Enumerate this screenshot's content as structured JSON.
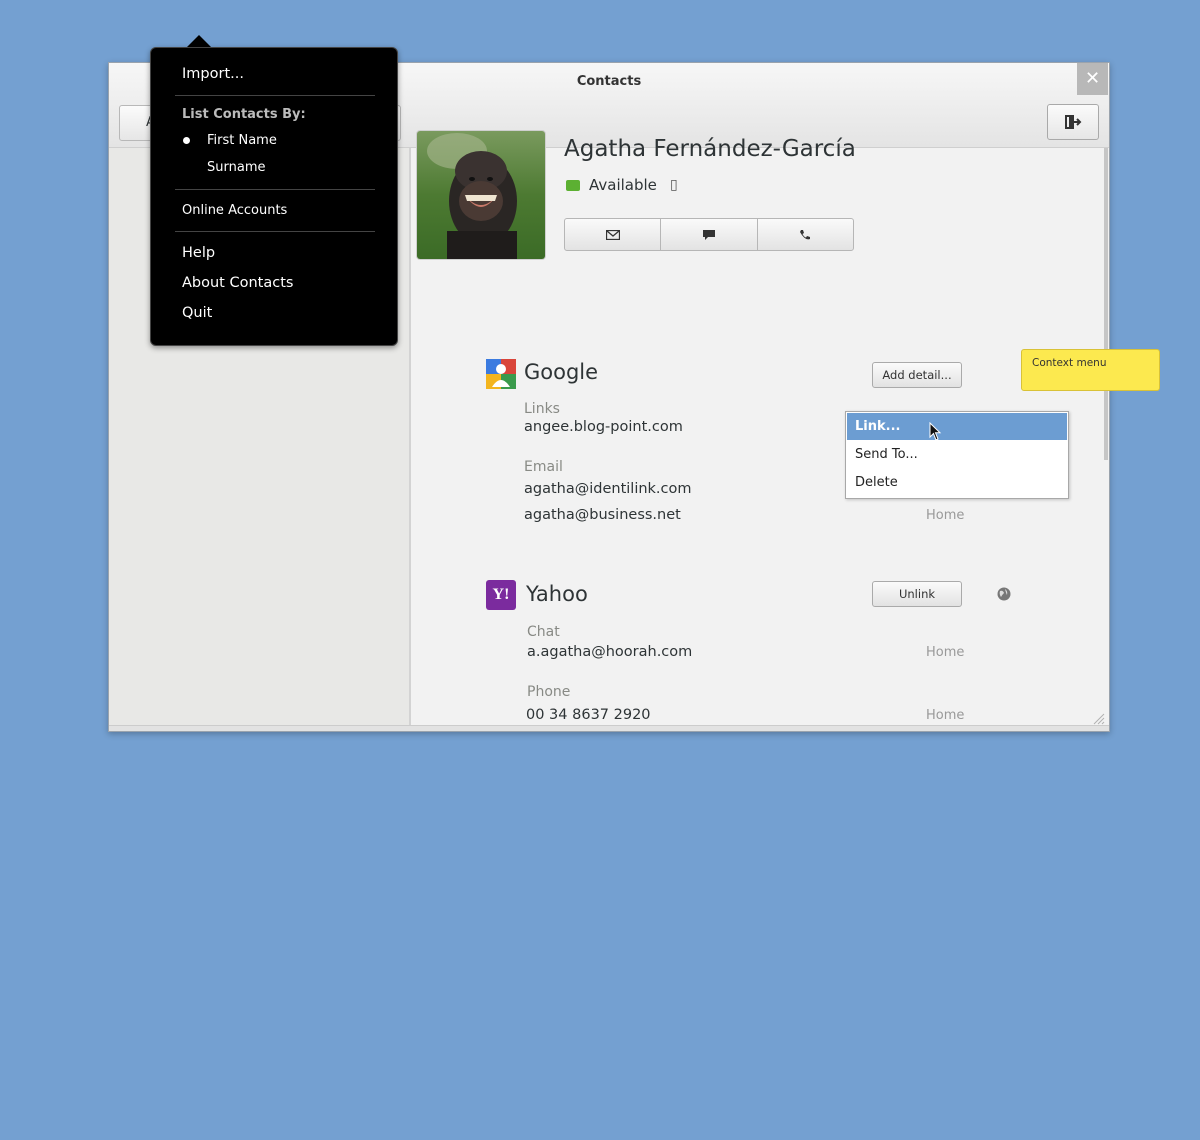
{
  "window": {
    "title": "Contacts",
    "close_label": "✕",
    "add_label": "A"
  },
  "contact": {
    "name": "Agatha Fernández-García",
    "presence": "Available"
  },
  "google": {
    "service": "Google",
    "add_detail": "Add detail...",
    "links_label": "Links",
    "link_value": "angee.blog-point.com",
    "email_label": "Email",
    "email1": "agatha@identilink.com",
    "email2": "agatha@business.net",
    "email2_type": "Home"
  },
  "yahoo": {
    "service": "Yahoo",
    "icon_text": "Y!",
    "unlink": "Unlink",
    "chat_label": "Chat",
    "chat_value": "a.agatha@hoorah.com",
    "chat_type": "Home",
    "phone_label": "Phone",
    "phone_value": "00 34 8637 2920",
    "phone_type": "Home"
  },
  "context_menu": {
    "items": [
      "Link...",
      "Send To...",
      "Delete"
    ]
  },
  "note": "Context menu",
  "app_menu": {
    "import": "Import...",
    "list_by": "List Contacts By:",
    "first_name": "First Name",
    "surname": "Surname",
    "online_accounts": "Online Accounts",
    "help": "Help",
    "about": "About Contacts",
    "quit": "Quit"
  },
  "colors": {
    "desktop": "#74a0d1",
    "selection": "#6c9dd2",
    "note": "#fce94f",
    "presence": "#5cb032"
  }
}
